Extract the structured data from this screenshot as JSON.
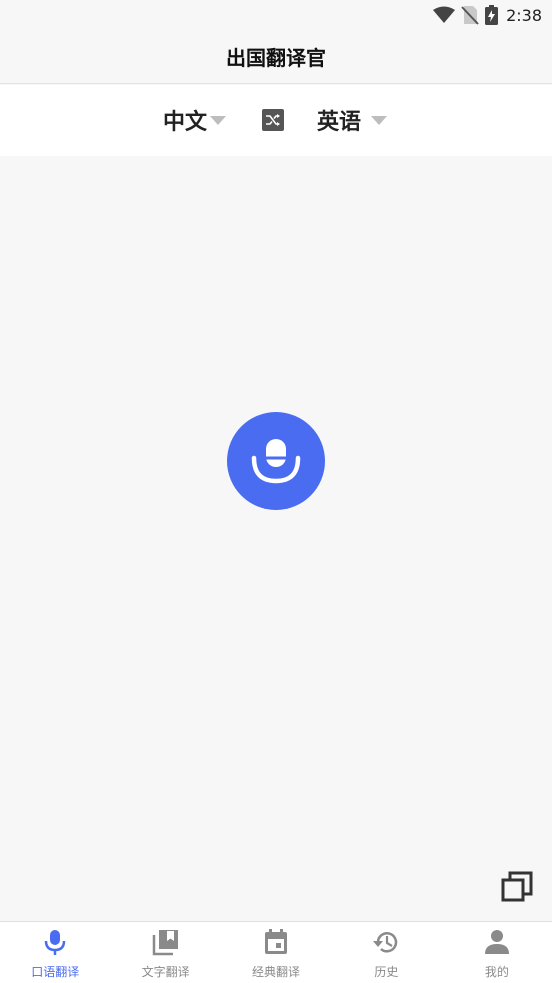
{
  "status_bar": {
    "time": "2:38",
    "icons": [
      "wifi-icon",
      "no-sim-icon",
      "battery-charging-icon"
    ]
  },
  "header": {
    "title": "出国翻译官"
  },
  "language_bar": {
    "source_lang": "中文",
    "target_lang": "英语",
    "swap_icon": "shuffle-icon"
  },
  "main": {
    "mic_icon": "microphone-icon",
    "copy_icon": "copy-icon"
  },
  "tabs": [
    {
      "label": "口语翻译",
      "icon": "mic-icon",
      "active": true
    },
    {
      "label": "文字翻译",
      "icon": "library-icon",
      "active": false
    },
    {
      "label": "经典翻译",
      "icon": "calendar-icon",
      "active": false
    },
    {
      "label": "历史",
      "icon": "history-icon",
      "active": false
    },
    {
      "label": "我的",
      "icon": "person-icon",
      "active": false
    }
  ],
  "colors": {
    "accent": "#4a6cf0",
    "inactive": "#8a8a8a",
    "background": "#f7f7f7"
  }
}
